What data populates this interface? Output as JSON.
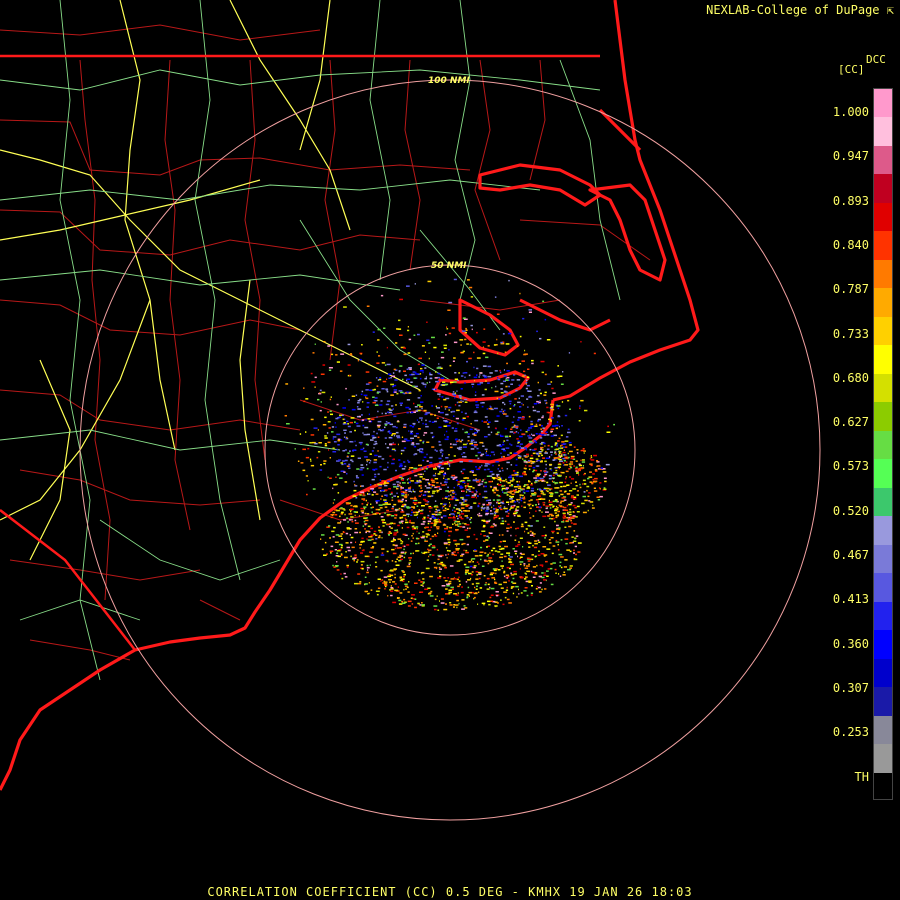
{
  "header": {
    "credit": "NEXLAB-College of DuPage",
    "logo_glyph": "⇱"
  },
  "product": {
    "code": "DCC",
    "unit": "[CC]",
    "caption": "CORRELATION COEFFICIENT (CC) 0.5 DEG - KMHX 19 JAN 26 18:03"
  },
  "range_rings": {
    "outer_label": "100 NMI",
    "inner_label": "50 NMI"
  },
  "legend": {
    "ticks": [
      "1.000",
      "0.947",
      "0.893",
      "0.840",
      "0.787",
      "0.733",
      "0.680",
      "0.627",
      "0.573",
      "0.520",
      "0.467",
      "0.413",
      "0.360",
      "0.307",
      "0.253",
      "TH"
    ],
    "colors": [
      "#ff99cc",
      "#ffbfdd",
      "#dd5a8a",
      "#c00020",
      "#e00000",
      "#ff3300",
      "#ff7a00",
      "#ffaa00",
      "#ffd000",
      "#ffff00",
      "#d4e000",
      "#8ccc00",
      "#66dd44",
      "#55ff55",
      "#3cc86c",
      "#9999dd",
      "#7a7ad8",
      "#5858e0",
      "#2222ee",
      "#0000ff",
      "#0000cc",
      "#1a1aa8",
      "#888899",
      "#999999",
      "#000000"
    ]
  },
  "colors": {
    "state_border": "#ff1a1a",
    "county_border": "#b81818",
    "highway": "#ffff55",
    "road": "#88dd88",
    "ring": "#f0a0a0",
    "text": "#ffff66"
  }
}
